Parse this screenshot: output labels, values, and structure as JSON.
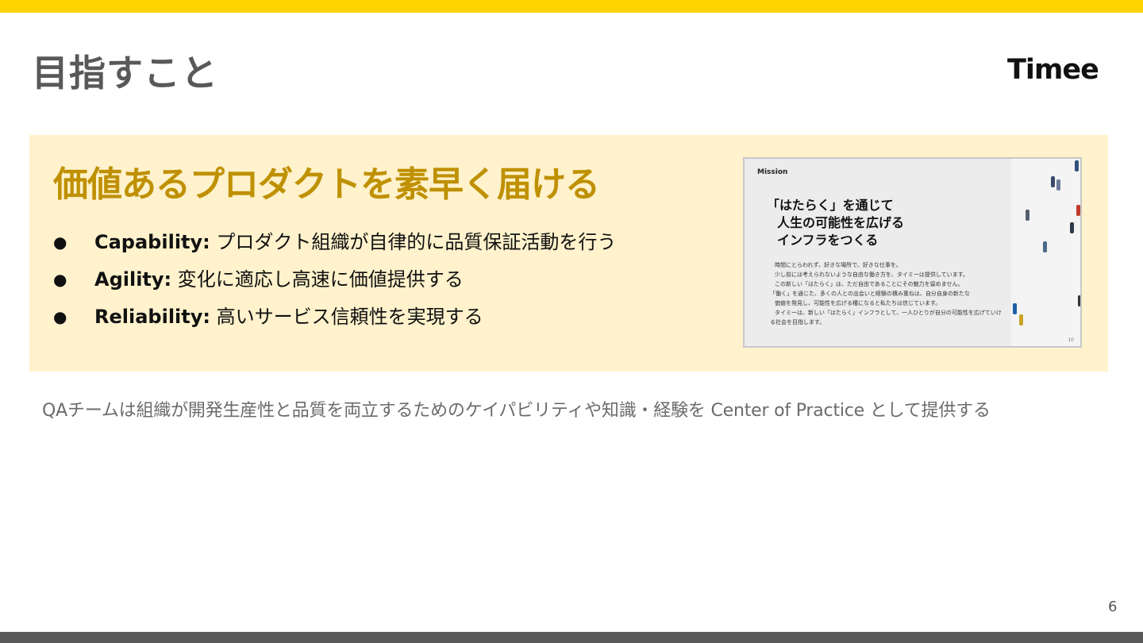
{
  "slide": {
    "title": "目指すこと",
    "logo": "Timee",
    "page_number": "6"
  },
  "panel": {
    "title": "価値あるプロダクトを素早く届ける",
    "bullets": [
      {
        "term": "Capability:",
        "text": " プロダクト組織が自律的に品質保証活動を行う"
      },
      {
        "term": "Agility:",
        "text": " 変化に適応し高速に価値提供する"
      },
      {
        "term": "Reliability:",
        "text": " 高いサービス信頼性を実現する"
      }
    ],
    "bullet_glyph": "●"
  },
  "thumbnail": {
    "label": "Mission",
    "headline": [
      "「はたらく」を通じて",
      "人生の可能性を広げる",
      "インフラをつくる"
    ],
    "body": [
      "時間にとらわれず、好きな場所で、好きな仕事を。",
      "少し前には考えられないような自由な働き方を、タイミーは提供しています。",
      "この新しい「はたらく」は、ただ自由であることにその魅力を留めません。",
      "「働く」を通じた、多くの人との出会いと経験の積み重ねは、自分自身の新たな",
      "価値を発見し、可能性を広げる種になると私たちは信じています。",
      "タイミーは、新しい「はたらく」インフラとして、一人ひとりが自分の可能性を広げていけ",
      "る社会を目指します。"
    ],
    "page": "10"
  },
  "footer": {
    "text": "QAチームは組織が開発生産性と品質を両立するためのケイパビリティや知識・経験を Center of Practice として提供する"
  },
  "colors": {
    "accent_yellow": "#ffd400",
    "panel_bg": "#fff2cc",
    "panel_title": "#bf9000",
    "title_gray": "#595959",
    "bottom_bar": "#595959"
  }
}
